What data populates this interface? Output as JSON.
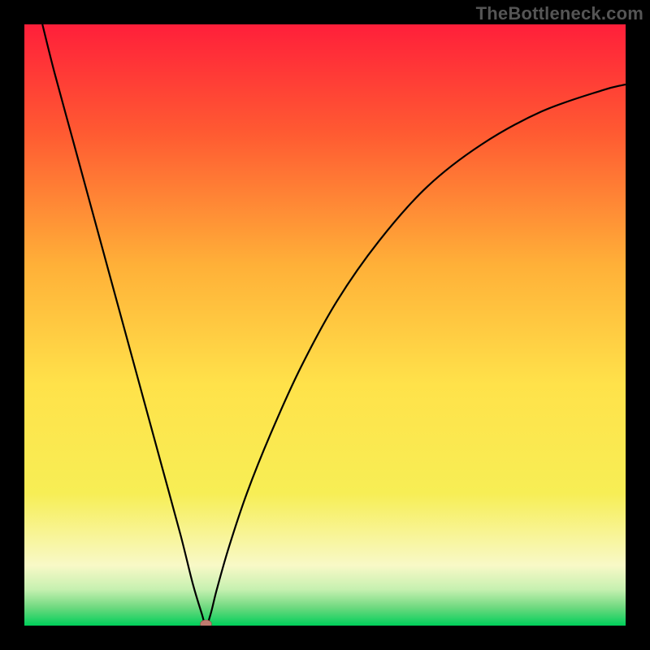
{
  "watermark": "TheBottleneck.com",
  "colors": {
    "frame": "#000000",
    "curve": "#000000",
    "marker_fill": "#c07b70",
    "marker_stroke": "#8f4c42",
    "grad_top": "#ff1f3a",
    "grad_mid_upper": "#ff7a2a",
    "grad_mid": "#ffd23a",
    "grad_mid_lower": "#f7ee55",
    "grad_pale": "#f8f9c7",
    "grad_green_soft": "#8ee29b",
    "grad_green": "#00cf5a"
  },
  "chart_data": {
    "type": "line",
    "title": "",
    "xlabel": "",
    "ylabel": "",
    "xlim": [
      0,
      100
    ],
    "ylim": [
      0,
      100
    ],
    "gradient_stops": [
      {
        "offset": 0,
        "color": "#ff1f3a"
      },
      {
        "offset": 18,
        "color": "#ff5a32"
      },
      {
        "offset": 40,
        "color": "#ffb038"
      },
      {
        "offset": 60,
        "color": "#ffe24a"
      },
      {
        "offset": 78,
        "color": "#f7ee55"
      },
      {
        "offset": 90,
        "color": "#f8f9c7"
      },
      {
        "offset": 94,
        "color": "#c6f0b0"
      },
      {
        "offset": 97,
        "color": "#6ed97f"
      },
      {
        "offset": 100,
        "color": "#00cf5a"
      }
    ],
    "series": [
      {
        "name": "bottleneck-curve",
        "x": [
          3,
          5,
          8,
          11,
          14,
          17,
          20,
          23,
          26,
          28,
          29.5,
          30.2,
          31,
          32,
          34,
          37,
          41,
          46,
          52,
          59,
          67,
          76,
          86,
          96,
          100
        ],
        "y": [
          100,
          92,
          81,
          70,
          59,
          48,
          37,
          26,
          15,
          7,
          2,
          0,
          2,
          6,
          13,
          22,
          32,
          43,
          54,
          64,
          73,
          80,
          85.5,
          89,
          90
        ]
      }
    ],
    "vertex": {
      "x": 30.2,
      "y": 0
    }
  }
}
